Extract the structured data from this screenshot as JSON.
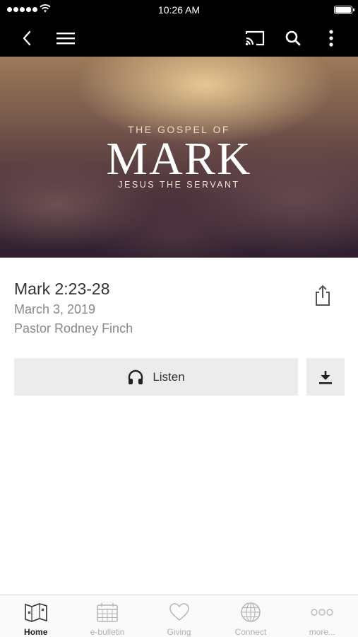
{
  "status_bar": {
    "time": "10:26 AM"
  },
  "app_bar": {
    "icons": [
      "back-icon",
      "menu-icon",
      "cast-icon",
      "search-icon",
      "more-vertical-icon"
    ]
  },
  "hero": {
    "overline": "THE GOSPEL OF",
    "title": "MARK",
    "subtitle": "JESUS THE  SERVANT"
  },
  "sermon": {
    "passage": "Mark 2:23-28",
    "date": "March 3, 2019",
    "speaker": "Pastor Rodney Finch"
  },
  "actions": {
    "listen_label": "Listen",
    "listen_icon": "headphones-icon",
    "download_icon": "download-icon",
    "share_icon": "share-icon"
  },
  "tab_bar": {
    "tabs": [
      {
        "label": "Home",
        "icon": "map-icon",
        "active": true
      },
      {
        "label": "e-bulletin",
        "icon": "calendar-icon",
        "active": false
      },
      {
        "label": "Giving",
        "icon": "heart-icon",
        "active": false
      },
      {
        "label": "Connect",
        "icon": "globe-icon",
        "active": false
      },
      {
        "label": "more...",
        "icon": "more-horizontal-icon",
        "active": false
      }
    ]
  },
  "colors": {
    "bars": "#000000",
    "button_bg": "#ececec",
    "muted_text": "#888888",
    "tab_inactive": "#b0b0b0"
  }
}
